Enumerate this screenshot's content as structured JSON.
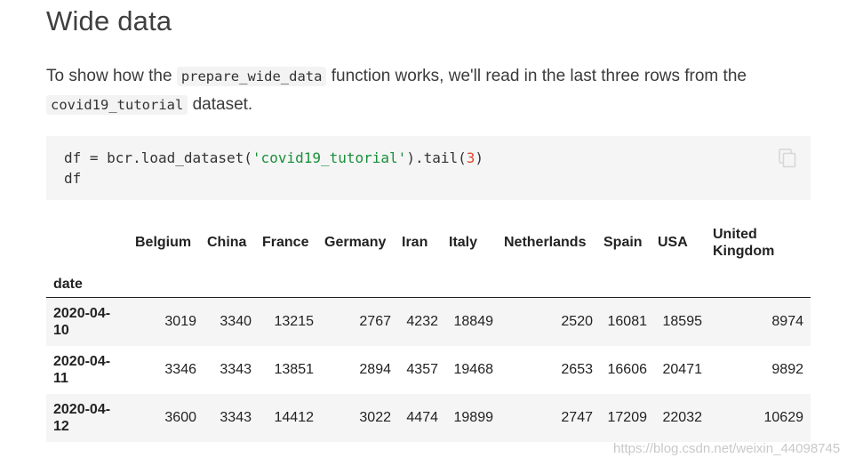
{
  "page": {
    "title": "Wide data",
    "intro": {
      "text_1": "To show how the ",
      "code_1": "prepare_wide_data",
      "text_2": " function works, we'll read in the last three rows from the ",
      "code_2": "covid19_tutorial",
      "text_3": " dataset."
    }
  },
  "code_block": {
    "line1_prefix": "df = bcr.load_dataset(",
    "line1_string": "'covid19_tutorial'",
    "line1_mid": ").tail(",
    "line1_number": "3",
    "line1_suffix": ")",
    "line2": "df",
    "copy_icon": "copy-icon"
  },
  "table": {
    "index_name": "date",
    "columns": [
      "Belgium",
      "China",
      "France",
      "Germany",
      "Iran",
      "Italy",
      "Netherlands",
      "Spain",
      "USA",
      "United Kingdom"
    ],
    "rows": [
      {
        "date": "2020-04-10",
        "values": [
          "3019",
          "3340",
          "13215",
          "2767",
          "4232",
          "18849",
          "2520",
          "16081",
          "18595",
          "8974"
        ]
      },
      {
        "date": "2020-04-11",
        "values": [
          "3346",
          "3343",
          "13851",
          "2894",
          "4357",
          "19468",
          "2653",
          "16606",
          "20471",
          "9892"
        ]
      },
      {
        "date": "2020-04-12",
        "values": [
          "3600",
          "3343",
          "14412",
          "3022",
          "4474",
          "19899",
          "2747",
          "17209",
          "22032",
          "10629"
        ]
      }
    ]
  },
  "watermark": "https://blog.csdn.net/weixin_44098745"
}
